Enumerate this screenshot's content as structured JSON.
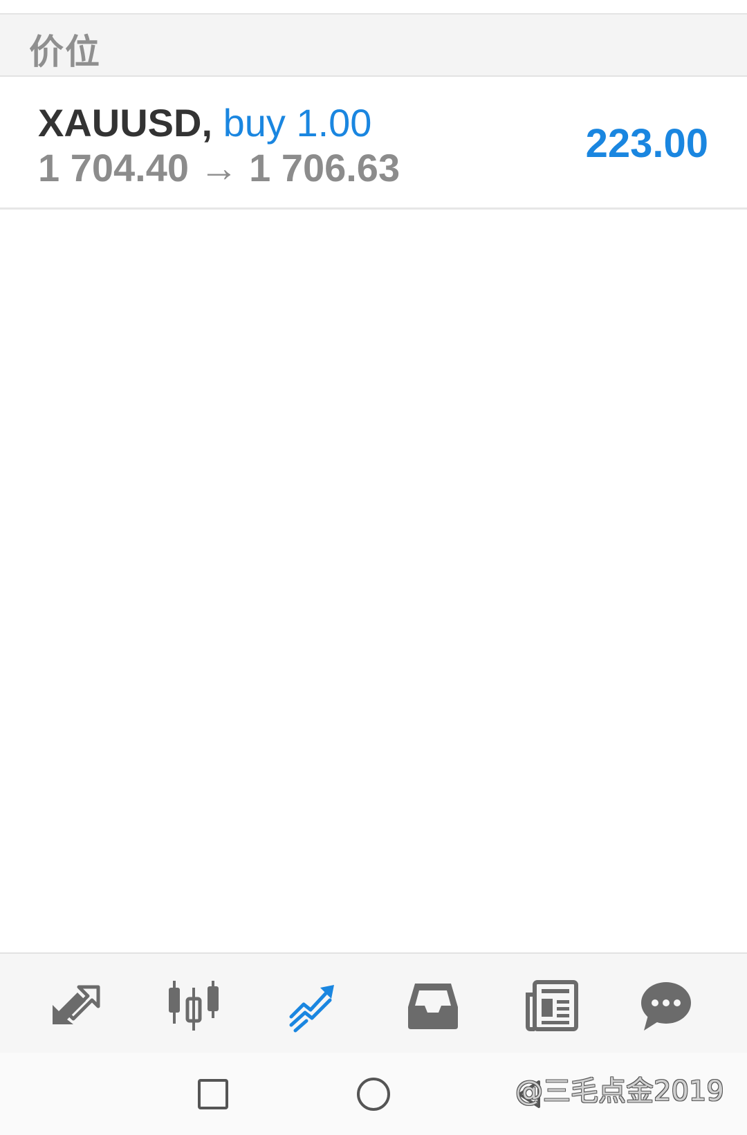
{
  "section": {
    "title": "价位"
  },
  "position": {
    "symbol": "XAUUSD,",
    "side_volume": "buy 1.00",
    "open_price": "1 704.40",
    "arrow": "→",
    "current_price": "1 706.63",
    "profit": "223.00"
  },
  "nav": {
    "items": [
      {
        "icon": "quotes-icon",
        "active": false
      },
      {
        "icon": "chart-icon",
        "active": false
      },
      {
        "icon": "trade-icon",
        "active": true
      },
      {
        "icon": "history-icon",
        "active": false
      },
      {
        "icon": "news-icon",
        "active": false
      },
      {
        "icon": "chat-icon",
        "active": false
      }
    ]
  },
  "system_nav": [
    "recents-button",
    "home-button",
    "back-button"
  ],
  "watermark": "@三毛点金2019",
  "colors": {
    "accent": "#1a86e0",
    "icon_gray": "#6b6b6b",
    "text_gray": "#8c8c8c"
  }
}
